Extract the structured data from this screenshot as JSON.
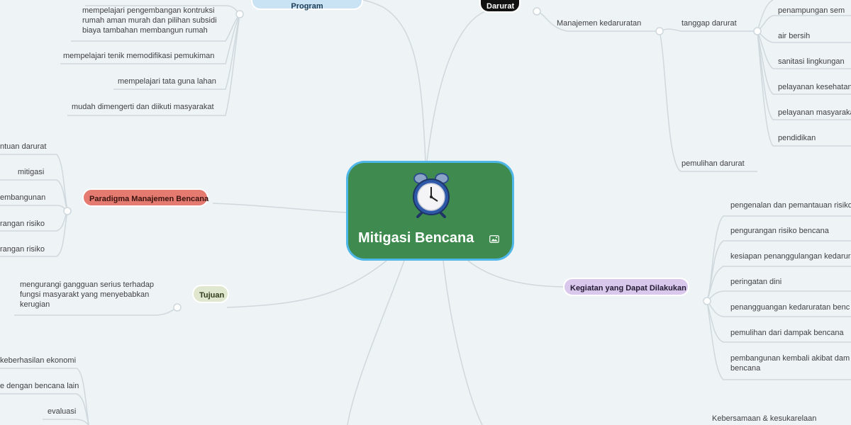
{
  "root": {
    "title": "Mitigasi Bencana",
    "image_icon": "image-icon",
    "illustration": "alarm-clock-icon"
  },
  "branches": {
    "program": {
      "label": "Program",
      "color": "#c9e3f5",
      "items": [
        "mempelajari pengembangan kontruksi rumah aman murah dan pilihan subsidi biaya tambahan membangun rumah",
        "mempelajari tenik memodifikasi pemukiman",
        "mempelajari tata guna lahan",
        "mudah dimengerti dan diikuti masyarakat"
      ]
    },
    "darurat": {
      "label": "Darurat",
      "color": "#111111",
      "manajemen": "Manajemen kedaruratan",
      "tanggap": "tanggap darurat",
      "tanggap_items": [
        "penampungan sem",
        "air bersih",
        "sanitasi lingkungan",
        "pelayanan kesehatan",
        "pelayanan masyarakat",
        "pendidikan"
      ],
      "pemulihan": "pemulihan darurat"
    },
    "paradigma": {
      "label": "Paradigma Manajemen Bencana",
      "color": "#e57b70",
      "items": [
        "ntuan darurat",
        "mitigasi",
        "embangunan",
        "rangan risiko",
        "rangan risiko"
      ]
    },
    "tujuan": {
      "label": "Tujuan",
      "color": "#dfe8cf",
      "items": [
        "mengurangi gangguan serius terhadap fungsi masyarakt yang menyebabkan kerugian"
      ]
    },
    "kegiatan": {
      "label": "Kegiatan yang Dapat Dilakukan",
      "color": "#d9c8ec",
      "items": [
        "pengenalan dan pemantauan risiko",
        "pengurangan risiko bencana",
        "kesiapan penanggulangan kedarurat",
        "peringatan dini",
        "penangguangan kedaruratan benc",
        "pemulihan dari dampak bencana",
        "pembangunan kembali akibat dam bencana"
      ]
    },
    "bottom_left": {
      "items": [
        "keberhasilan ekonomi",
        "e dengan bencana lain",
        "evaluasi"
      ]
    },
    "bottom_right": {
      "items": [
        "Kebersamaan & kesukarelaan"
      ]
    }
  }
}
